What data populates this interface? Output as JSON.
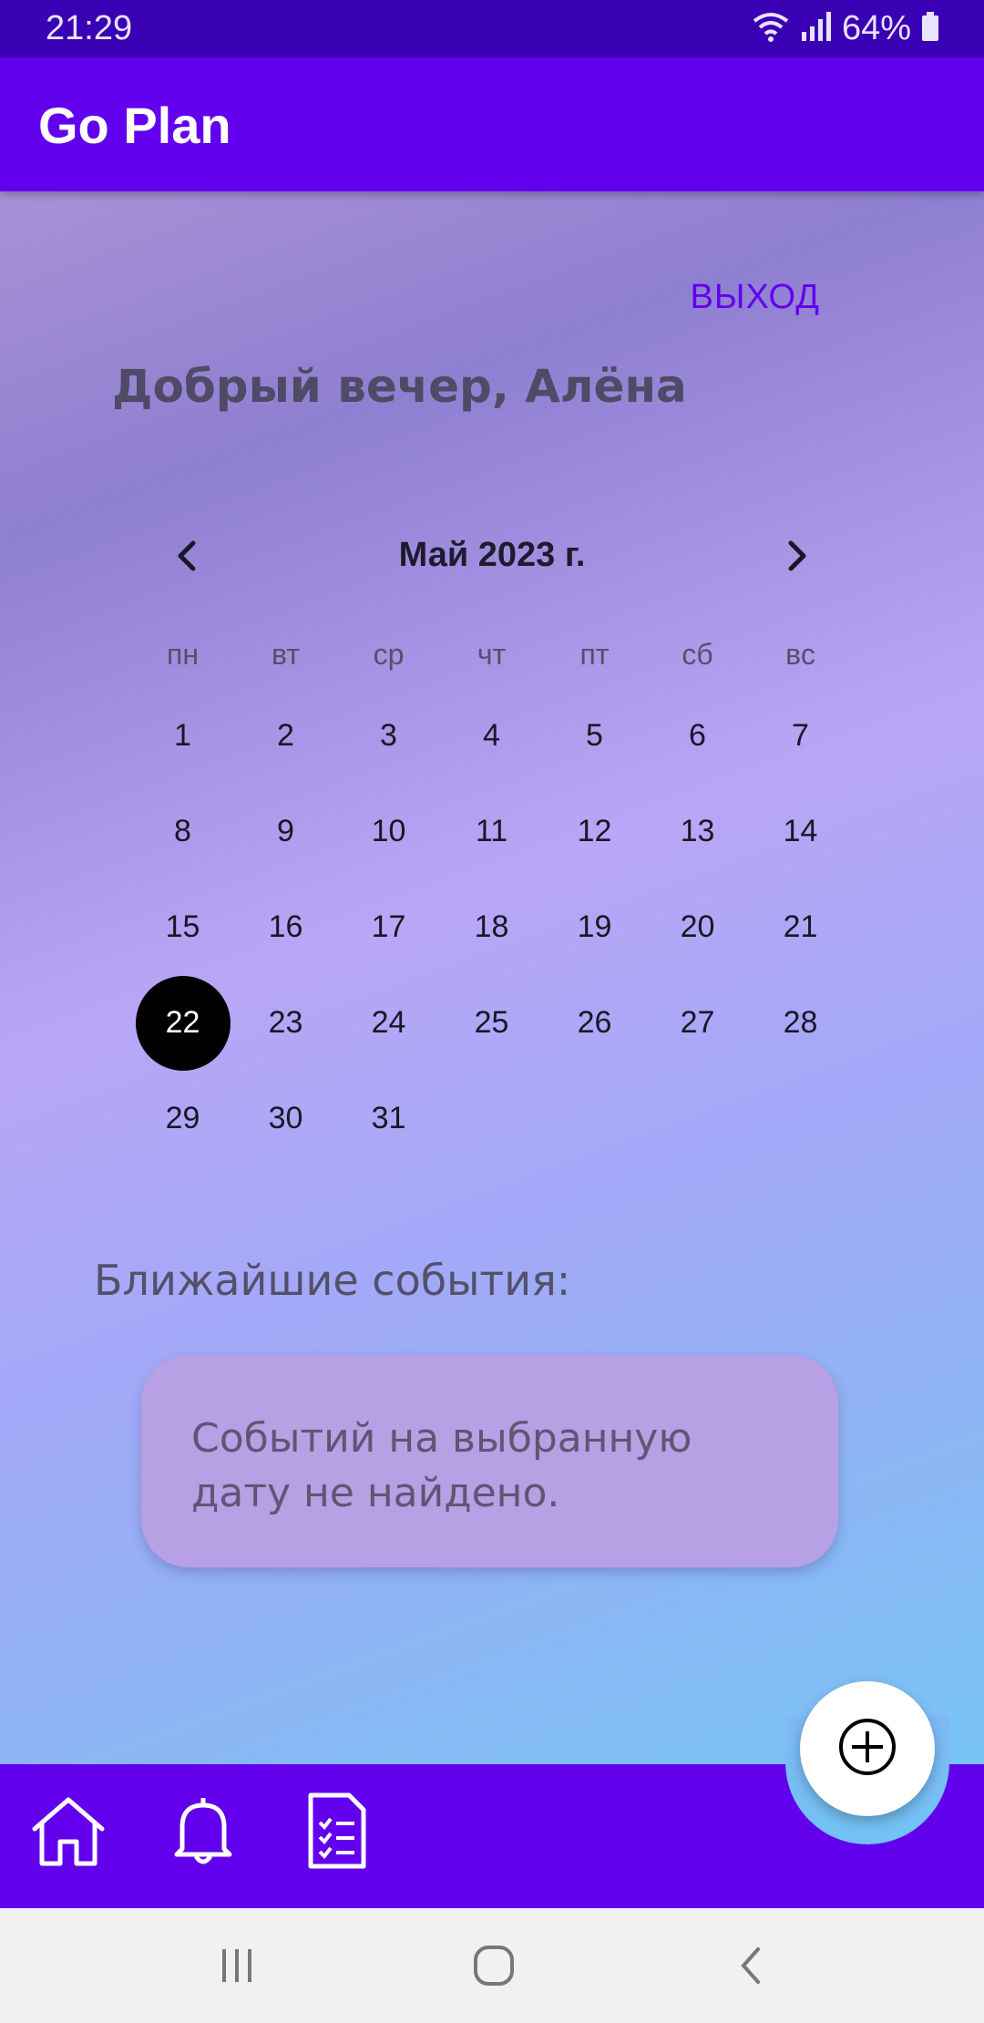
{
  "status_bar": {
    "time": "21:29",
    "battery": "64%",
    "icons": [
      "wifi-icon",
      "signal-icon",
      "battery-icon"
    ]
  },
  "app": {
    "title": "Go Plan"
  },
  "header": {
    "logout_label": "ВЫХОД",
    "greeting": "Добрый вечер, Алёна"
  },
  "calendar": {
    "month_label": "Май 2023 г.",
    "weekdays": [
      "пн",
      "вт",
      "ср",
      "чт",
      "пт",
      "сб",
      "вс"
    ],
    "days": [
      "1",
      "2",
      "3",
      "4",
      "5",
      "6",
      "7",
      "8",
      "9",
      "10",
      "11",
      "12",
      "13",
      "14",
      "15",
      "16",
      "17",
      "18",
      "19",
      "20",
      "21",
      "22",
      "23",
      "24",
      "25",
      "26",
      "27",
      "28",
      "29",
      "30",
      "31"
    ],
    "selected_day": "22"
  },
  "events": {
    "title": "Ближайшие события:",
    "empty_message": "Событий на выбранную дату не найдено."
  },
  "bottom_nav": {
    "items": [
      "home-icon",
      "bell-icon",
      "checklist-icon"
    ],
    "fab_icon": "add-circle-icon"
  },
  "system_nav": {
    "items": [
      "recent-apps-icon",
      "home-button-icon",
      "back-icon"
    ]
  },
  "colors": {
    "primary": "#6200ee",
    "status_bar": "#3a00b3",
    "selected_day": "#000000",
    "card": "#b7a0e3"
  }
}
